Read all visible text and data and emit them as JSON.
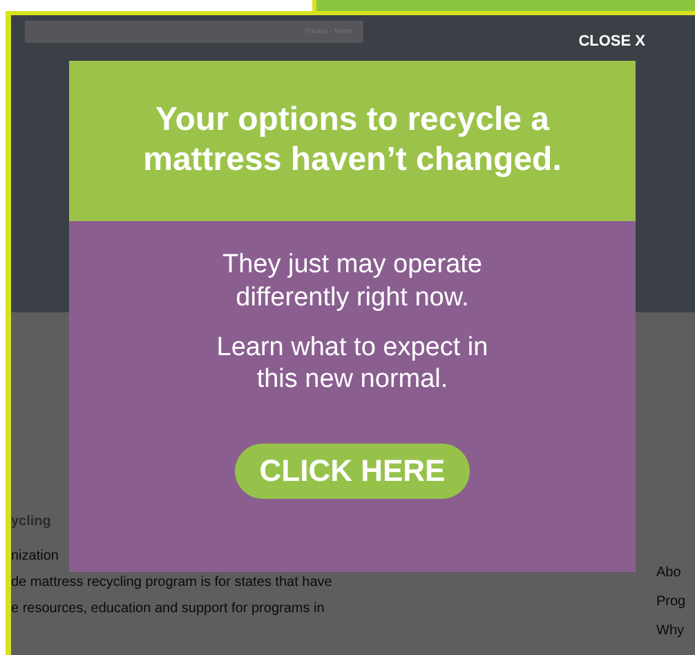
{
  "page": {
    "footer_links": "Privacy - Terms",
    "section_heading": "ycling",
    "body_lines": [
      "nization",
      "de mattress recycling program is for states that have",
      "e resources, education and support for programs in"
    ],
    "side_links": [
      "Abo",
      "Prog",
      "Why"
    ]
  },
  "modal": {
    "close": "CLOSE X",
    "heading": "Your options to recycle a mattress haven’t changed.",
    "paragraphs": [
      "They just may operate differently right now.",
      "Learn what to expect in this new normal."
    ],
    "button": "CLICK HERE"
  }
}
